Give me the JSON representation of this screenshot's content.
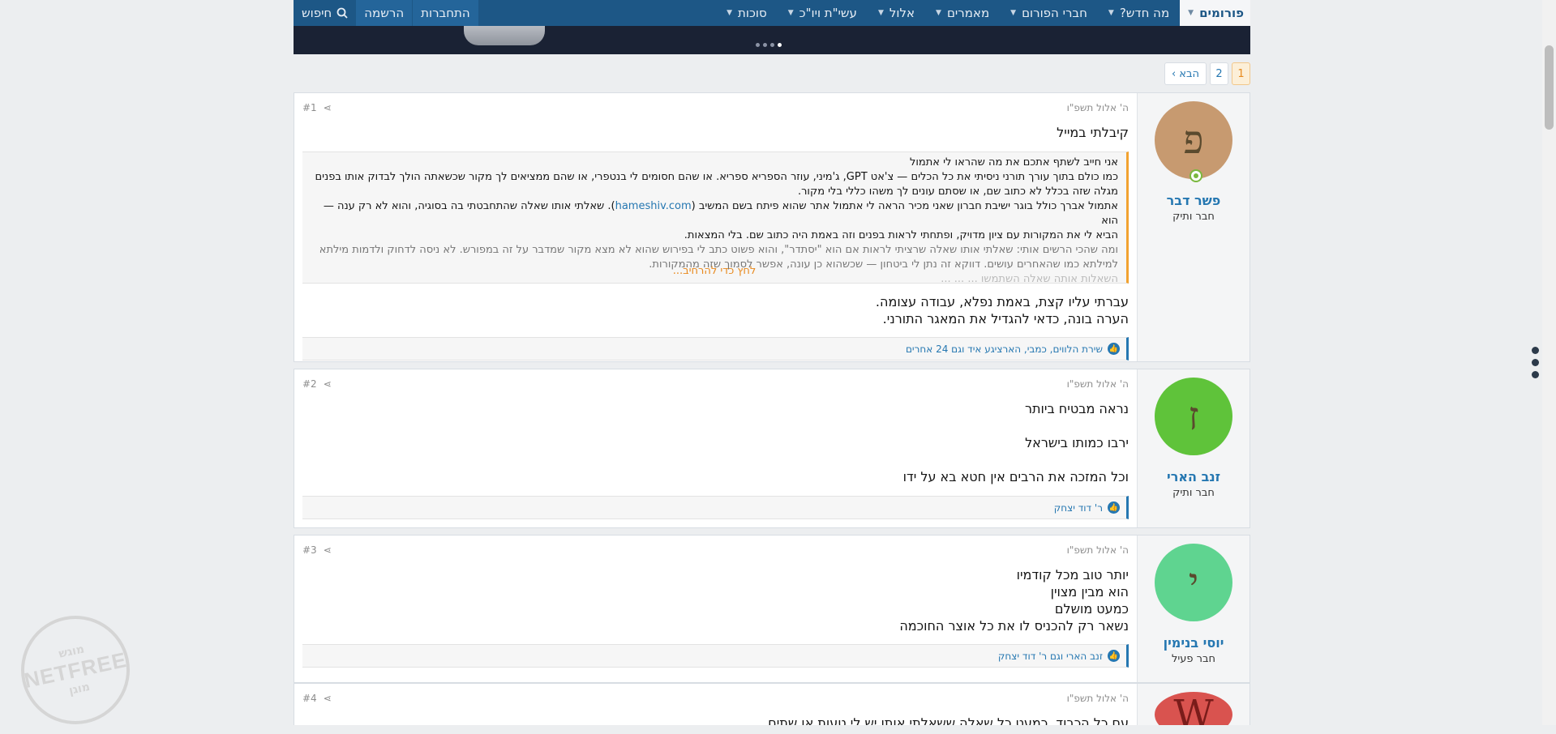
{
  "nav": {
    "forums": "פורומים",
    "whats_new": "מה חדש?",
    "members": "חברי הפורום",
    "articles": "מאמרים",
    "elul": "אלול",
    "ase_yk": "עשי\"ת ויו\"כ",
    "sukkot": "סוכות",
    "login": "התחברות",
    "register": "הרשמה",
    "search": "חיפוש"
  },
  "pagination": {
    "pages": [
      "1",
      "2"
    ],
    "next": "הבא ›"
  },
  "posts": [
    {
      "number": "#1",
      "date": "ה' אלול תשפ\"ו",
      "avatar_letter": "פ",
      "avatar_color": "#c79a70",
      "username": "פשר דבר",
      "user_title": "חבר ותיק",
      "title_line": "קיבלתי במייל",
      "quote_lines": [
        "אני חייב לשתף אתכם את מה שהראו לי אתמול",
        "כמו כולם בתוך עורך תורני ניסיתי את כל הכלים — צ'אט GPT, ג'מיני, עוזר הספריא ספריא. או שהם חסומים לי בנטפרי, או שהם ממציאים לך מקור שכשאתה הולך לבדוק אותו בפנים",
        "מגלה שזה בכלל לא כתוב שם, או שסתם עונים לך משהו כללי בלי מקור.",
        "אתמול אברך כולל בוגר ישיבת חברון שאני מכיר הראה לי אתמול אתר שהוא פיתח בשם המשיב (",
        "hameshiv.com",
        "). שאלתי אותו שאלה שהתחבטתי בה בסוגיה, והוא לא רק ענה — הוא",
        "הביא לי את המקורות עם ציון מדויק, ופתחתי לראות בפנים וזה באמת היה כתוב שם. בלי המצאות.",
        "ומה שהכי הרשים אותי: שאלתי אותו שאלה שרציתי לראות אם הוא \"יסתדר\", והוא פשוט כתב לי בפירוש שהוא לא מצא מקור שמדבר על זה במפורש. לא ניסה לדחוק ולדמות מילתא",
        "למילתא כמו שהאחרים עושים. דווקא זה נתן לי ביטחון — שכשהוא כן עונה, אפשר לסמוך שזה מהמקורות.",
        "השאלות אותה שאלה השתמשו ... ... ..."
      ],
      "expand_label": "לחץ כדי להרחיב...",
      "body_lines": [
        "עברתי עליו קצת, באמת נפלא, עבודה עצומה.",
        "הערה בונה, כדאי להגדיל את המאגר התורני."
      ],
      "reactions": "שירת הלווים, כמבי, הארציגע איד וגם 24 אחרים"
    },
    {
      "number": "#2",
      "date": "ה' אלול תשפ\"ו",
      "avatar_letter": "ז",
      "avatar_color": "#5fc33a",
      "username": "זנב הארי",
      "user_title": "חבר ותיק",
      "body_lines": [
        "נראה מבטיח ביותר",
        "",
        "ירבו כמותו בישראל",
        "",
        "וכל המזכה את הרבים אין חטא בא על ידו"
      ],
      "reactions": "ר' דוד יצחק"
    },
    {
      "number": "#3",
      "date": "ה' אלול תשפ\"ו",
      "avatar_letter": "י",
      "avatar_color": "#5fd490",
      "username": "יוסי בנימין",
      "user_title": "חבר פעיל",
      "body_lines": [
        "יותר טוב מכל קודמיו",
        "הוא מבין מצוין",
        "כמעט מושלם",
        "נשאר רק להכניס לו את כל אוצר החוכמה"
      ],
      "reactions": "זנב הארי וגם ר' דוד יצחק"
    },
    {
      "number": "#4",
      "date": "ה' אלול תשפ\"ו",
      "avatar_letter": "W",
      "avatar_color": "#d9534f",
      "body_lines": [
        "עם כל הכבוד, כמעט כל שאלה ששאלתי אותו יש לי טעות או שתים"
      ]
    }
  ],
  "watermark": {
    "top": "מוגש",
    "big": "NETFREE",
    "bottom": "מוגן"
  }
}
